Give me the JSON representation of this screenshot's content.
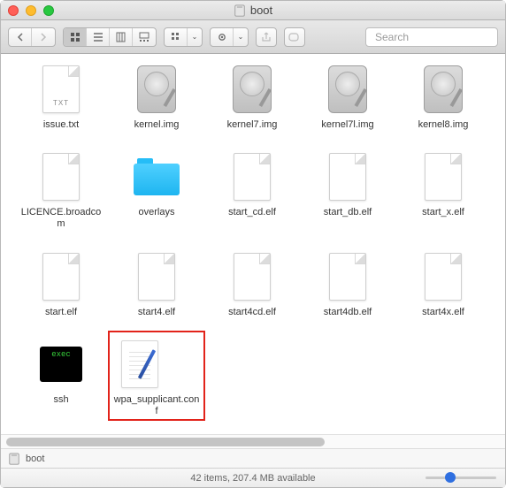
{
  "window": {
    "title": "boot"
  },
  "toolbar": {
    "search_placeholder": "Search"
  },
  "files": [
    {
      "name": "issue.txt",
      "kind": "txt"
    },
    {
      "name": "kernel.img",
      "kind": "img"
    },
    {
      "name": "kernel7.img",
      "kind": "img"
    },
    {
      "name": "kernel7l.img",
      "kind": "img"
    },
    {
      "name": "kernel8.img",
      "kind": "img"
    },
    {
      "name": "LICENCE.broadcom",
      "kind": "blank"
    },
    {
      "name": "overlays",
      "kind": "folder"
    },
    {
      "name": "start_cd.elf",
      "kind": "blank"
    },
    {
      "name": "start_db.elf",
      "kind": "blank"
    },
    {
      "name": "start_x.elf",
      "kind": "blank"
    },
    {
      "name": "start.elf",
      "kind": "blank"
    },
    {
      "name": "start4.elf",
      "kind": "blank"
    },
    {
      "name": "start4cd.elf",
      "kind": "blank"
    },
    {
      "name": "start4db.elf",
      "kind": "blank"
    },
    {
      "name": "start4x.elf",
      "kind": "blank"
    },
    {
      "name": "ssh",
      "kind": "exec"
    },
    {
      "name": "wpa_supplicant.conf",
      "kind": "conf",
      "highlighted": true
    }
  ],
  "pathbar": {
    "location": "boot"
  },
  "status": {
    "text": "42 items, 207.4 MB available"
  },
  "icon_badges": {
    "txt": "TXT",
    "exec": "exec"
  }
}
